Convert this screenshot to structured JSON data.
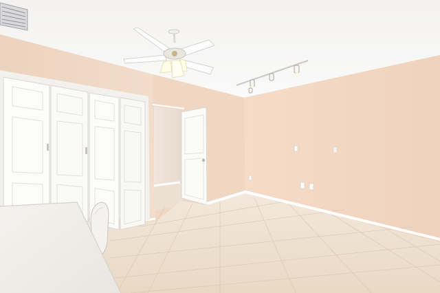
{
  "scene": {
    "kind": "interior-photo",
    "room": "empty bedroom",
    "colors": {
      "wall": "#f1d9c6",
      "ceiling": "#f7f6f4",
      "door": "#fbfbfa",
      "floor": "#ecdcc8",
      "baseboard": "#ffffff",
      "fan_blade": "#fdfdfd",
      "shade": "#fffde8"
    },
    "fixtures": [
      "ceiling-fan",
      "track-light",
      "bifold-closet-doors",
      "interior-door",
      "wall-outlet",
      "light-switch",
      "air-vent",
      "desk",
      "chair"
    ]
  }
}
